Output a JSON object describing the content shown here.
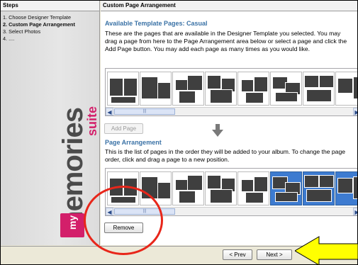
{
  "sidebar": {
    "title": "Steps",
    "steps": [
      {
        "label": "1. Choose Designer Template",
        "active": false
      },
      {
        "label": "2. Custom Page Arrangement",
        "active": true
      },
      {
        "label": "3. Select Photos",
        "active": false
      },
      {
        "label": "4. ....",
        "active": false
      }
    ],
    "logo": {
      "my": "my",
      "memories": "memories",
      "suite": "suite"
    }
  },
  "main": {
    "title": "Custom Page Arrangement",
    "available": {
      "heading": "Available Template Pages: Casual",
      "description": "These are the pages that are available in the Designer Template you selected. You may drag a page from here to the Page Arrangement area below or select a page and click the Add Page button. You may add each page as many times as you would like.",
      "add_button": "Add Page",
      "scroll_thumb_label": "|||"
    },
    "arrangement": {
      "heading": "Page Arrangement",
      "description": "This is the list of pages in the order they will be added to your album. To change the page order, click and drag a page to a new position.",
      "remove_button": "Remove",
      "scroll_thumb_label": "|||",
      "selected_pages": [
        5,
        6,
        7
      ]
    }
  },
  "footer": {
    "prev_button": "< Prev",
    "next_button": "Next >"
  },
  "colors": {
    "accent_title": "#3a72a6",
    "brand_pink": "#d31f6a",
    "annotation_red": "#e8261a",
    "annotation_yellow": "#ffff00"
  },
  "icons": {
    "scroll_left": "◀",
    "scroll_right": "▶"
  }
}
